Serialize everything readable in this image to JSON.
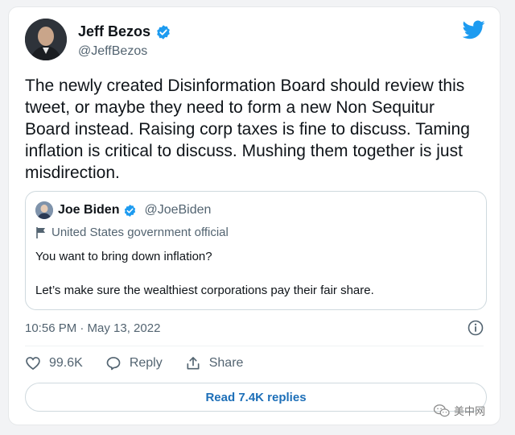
{
  "tweet": {
    "author_name": "Jeff Bezos",
    "author_handle": "@JeffBezos",
    "text": "The newly created Disinformation Board should review this tweet, or maybe they need to form a new Non Sequitur Board instead. Raising corp taxes is fine to discuss. Taming inflation is critical to discuss. Mushing them together is just misdirection.",
    "timestamp": "10:56 PM · May 13, 2022"
  },
  "quoted": {
    "author_name": "Joe Biden",
    "author_handle": "@JoeBiden",
    "label": "United States government official",
    "line1": "You want to bring down inflation?",
    "line2": "Let’s make sure the wealthiest corporations pay their fair share."
  },
  "actions": {
    "like_count": "99.6K",
    "reply_label": "Reply",
    "share_label": "Share"
  },
  "read_replies_label": "Read 7.4K replies",
  "watermark": {
    "text": "美中网"
  },
  "colors": {
    "twitter_blue": "#1d9bf0",
    "link_blue": "#1d6fb8",
    "secondary_text": "#536471"
  },
  "icons": [
    "avatar",
    "verified-badge-icon",
    "twitter-bird-icon",
    "flag-icon",
    "info-icon",
    "heart-icon",
    "reply-bubble-icon",
    "share-icon",
    "wechat-icon"
  ]
}
